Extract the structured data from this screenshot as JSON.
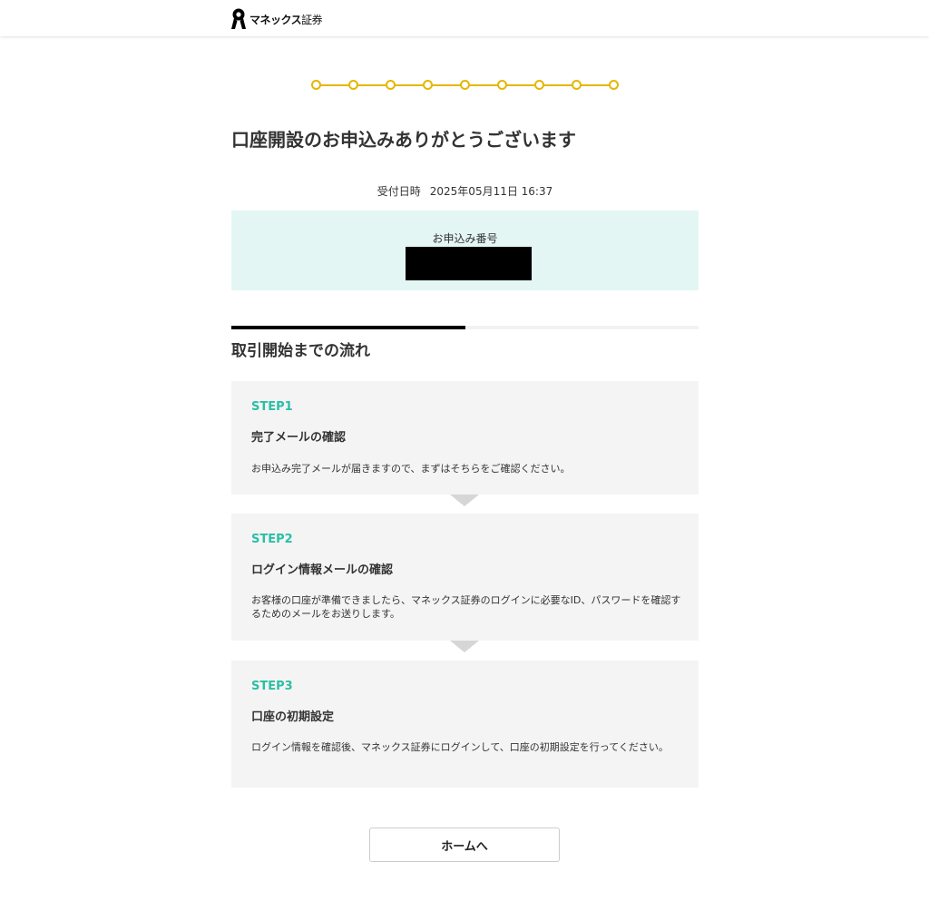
{
  "header": {
    "logo_brand": "マネックス",
    "logo_suffix": "証券"
  },
  "progress": {
    "total_steps": 9,
    "completed_steps": 9,
    "accent_color": "#e5b700"
  },
  "page_title": "口座開設のお申込みありがとうございます",
  "received": {
    "label": "受付日時",
    "datetime": "2025年05月11日 16:37"
  },
  "application_number": {
    "label": "お申込み番号",
    "value": ""
  },
  "flow": {
    "title": "取引開始までの流れ",
    "steps": [
      {
        "label": "STEP1",
        "title": "完了メールの確認",
        "description": "お申込み完了メールが届きますので、まずはそちらをご確認ください。"
      },
      {
        "label": "STEP2",
        "title": "ログイン情報メールの確認",
        "description": "お客様の口座が準備できましたら、マネックス証券のログインに必要なID、パスワードを確認するためのメールをお送りします。"
      },
      {
        "label": "STEP3",
        "title": "口座の初期設定",
        "description": "ログイン情報を確認後、マネックス証券にログインして、口座の初期設定を行ってください。"
      }
    ],
    "accent_color": "#2bbfa4"
  },
  "home_button_label": "ホームへ"
}
